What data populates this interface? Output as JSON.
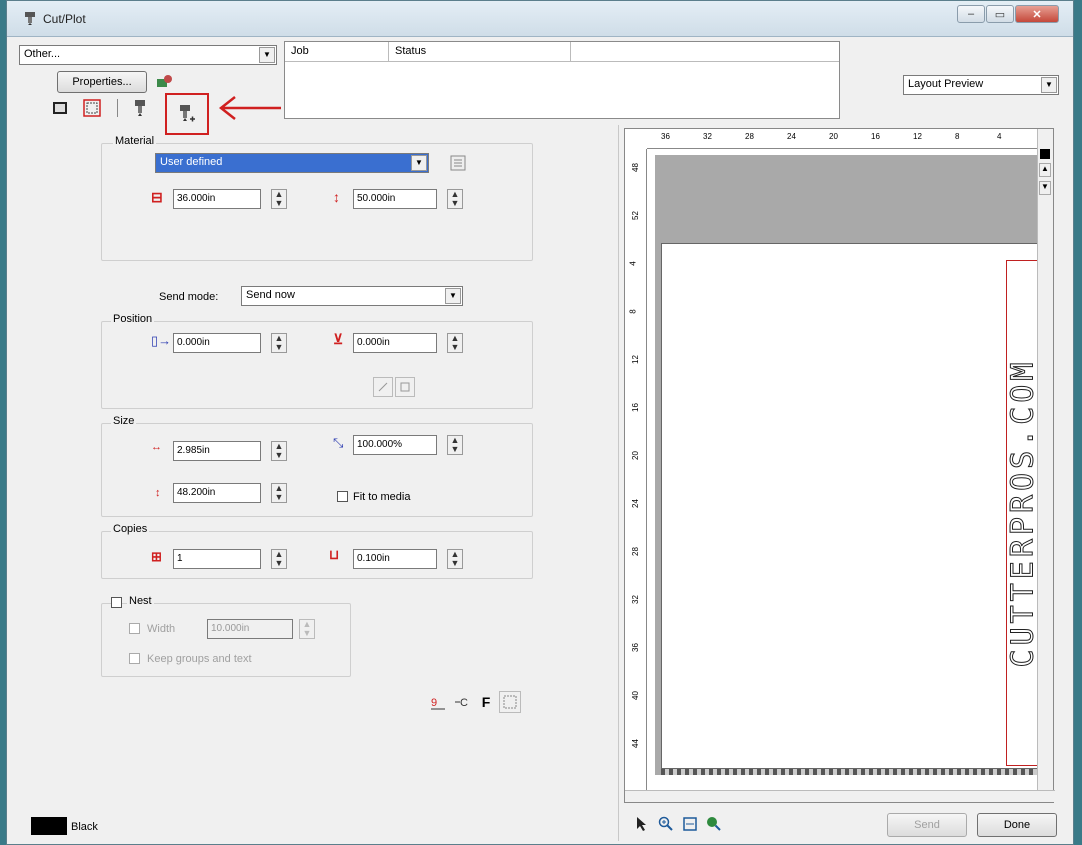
{
  "window": {
    "title": "Cut/Plot",
    "minimize": "–",
    "maximize": "▭",
    "close": "✕"
  },
  "device": {
    "selected": "Other...",
    "properties_label": "Properties..."
  },
  "job_list": {
    "columns": [
      "Job",
      "Status"
    ]
  },
  "view_mode": {
    "selected": "Layout Preview"
  },
  "material": {
    "group_label": "Material",
    "selected": "User defined",
    "width": "36.000in",
    "length": "50.000in"
  },
  "send_mode": {
    "label": "Send mode:",
    "selected": "Send now"
  },
  "position": {
    "group_label": "Position",
    "x": "0.000in",
    "y": "0.000in"
  },
  "size": {
    "group_label": "Size",
    "width": "2.985in",
    "scale": "100.000%",
    "height": "48.200in",
    "fit_to_media_label": "Fit to media"
  },
  "copies": {
    "group_label": "Copies",
    "count": "1",
    "spacing": "0.100in"
  },
  "nest": {
    "label": "Nest",
    "width_label": "Width",
    "width_value": "10.000in",
    "keep_groups_label": "Keep groups and text"
  },
  "bottom_tools": {
    "f_label": "F"
  },
  "ruler": {
    "h_ticks": [
      "36",
      "32",
      "28",
      "24",
      "20",
      "16",
      "12",
      "8",
      "4"
    ],
    "v_ticks": [
      "48",
      "52",
      "4",
      "8",
      "12",
      "16",
      "20",
      "24",
      "28",
      "32",
      "36",
      "40",
      "44"
    ]
  },
  "preview_text": "CUTTERPROS.COM",
  "status": {
    "color_name": "Black"
  },
  "footer": {
    "send_label": "Send",
    "done_label": "Done"
  },
  "colors": {
    "accent_red": "#d02020",
    "selection_blue": "#3a6fd0",
    "desktop": "#3a7a88"
  }
}
